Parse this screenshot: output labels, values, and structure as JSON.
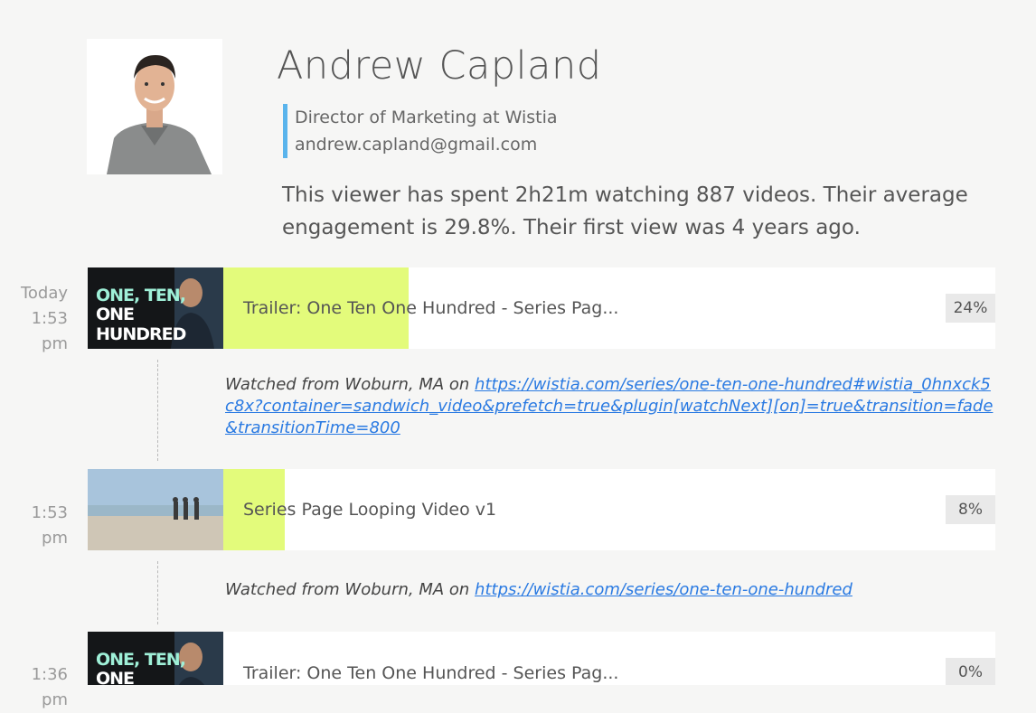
{
  "profile": {
    "name": "Andrew Capland",
    "title": "Director of Marketing at Wistia",
    "email": "andrew.capland@gmail.com",
    "summary": "This viewer has spent 2h21m watching 887 videos. Their average engagement is 29.8%. Their first view was 4 years ago."
  },
  "sessions": [
    {
      "day": "Today",
      "time": "1:53 pm",
      "video_title": "Trailer: One Ten One Hundred - Series Pag...",
      "engagement": "24%",
      "engagement_fraction": 0.24,
      "thumb_text_line1": "ONE, TEN,",
      "thumb_text_line2": "ONE HUNDRED",
      "note_prefix": "Watched from Woburn, MA on ",
      "note_link": "https://wistia.com/series/one-ten-one-hundred#wistia_0hnxck5c8x?container=sandwich_video&prefetch=true&plugin[watchNext][on]=true&transition=fade&transitionTime=800"
    },
    {
      "day": "",
      "time": "1:53 pm",
      "video_title": "Series Page Looping Video v1",
      "engagement": "8%",
      "engagement_fraction": 0.08,
      "note_prefix": "Watched from Woburn, MA on ",
      "note_link": "https://wistia.com/series/one-ten-one-hundred"
    },
    {
      "day": "",
      "time": "1:36 pm",
      "video_title": "Trailer: One Ten One Hundred - Series Pag...",
      "engagement": "0%",
      "engagement_fraction": 0.0,
      "thumb_text_line1": "ONE, TEN,",
      "thumb_text_line2": "ONE HUNDRED"
    }
  ],
  "colors": {
    "engagement_bar": "#e3fb7b",
    "meta_accent": "#5ab4ec",
    "link": "#2a7ae2"
  }
}
